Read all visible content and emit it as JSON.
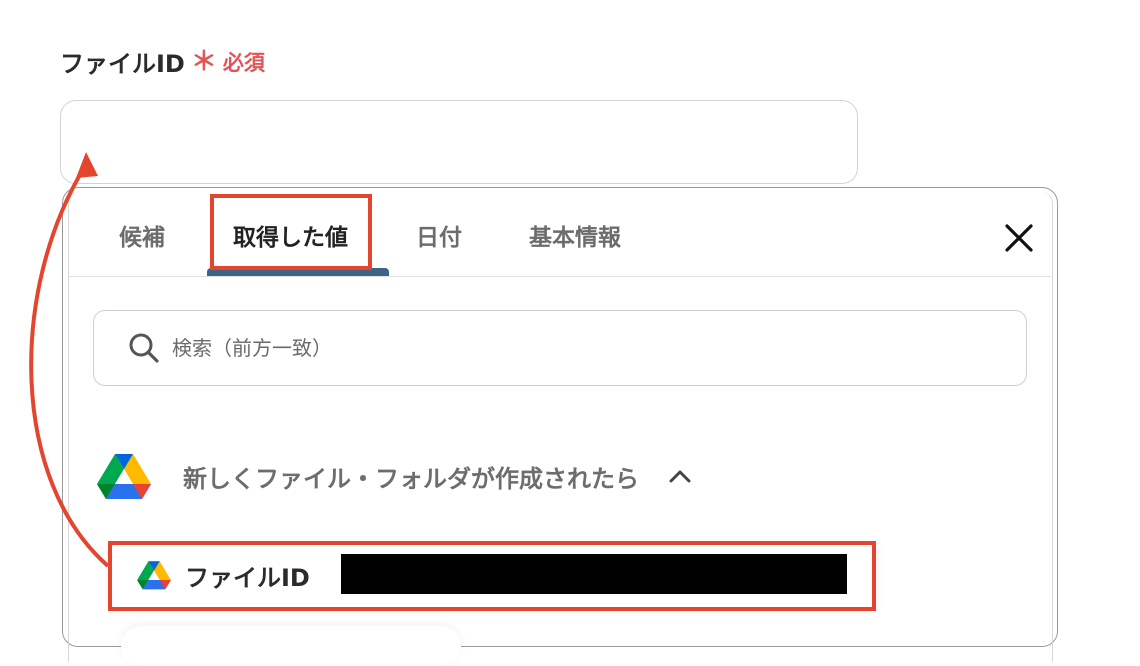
{
  "field": {
    "label": "ファイルID",
    "required_star": "＊",
    "required_text": "必須",
    "value": ""
  },
  "tabs": [
    {
      "label": "候補",
      "active": false
    },
    {
      "label": "取得した値",
      "active": true
    },
    {
      "label": "日付",
      "active": false
    },
    {
      "label": "基本情報",
      "active": false
    }
  ],
  "close_icon": "close-icon",
  "search": {
    "placeholder": "検索（前方一致）",
    "icon": "search-icon"
  },
  "group": {
    "icon": "google-drive-icon",
    "title": "新しくファイル・フォルダが作成されたら",
    "expanded": true
  },
  "result_item": {
    "icon": "google-drive-icon",
    "label": "ファイルID",
    "value_redacted": true
  },
  "colors": {
    "highlight": "#e4452e",
    "required": "#e05656",
    "tab_underline": "#3c6585"
  }
}
